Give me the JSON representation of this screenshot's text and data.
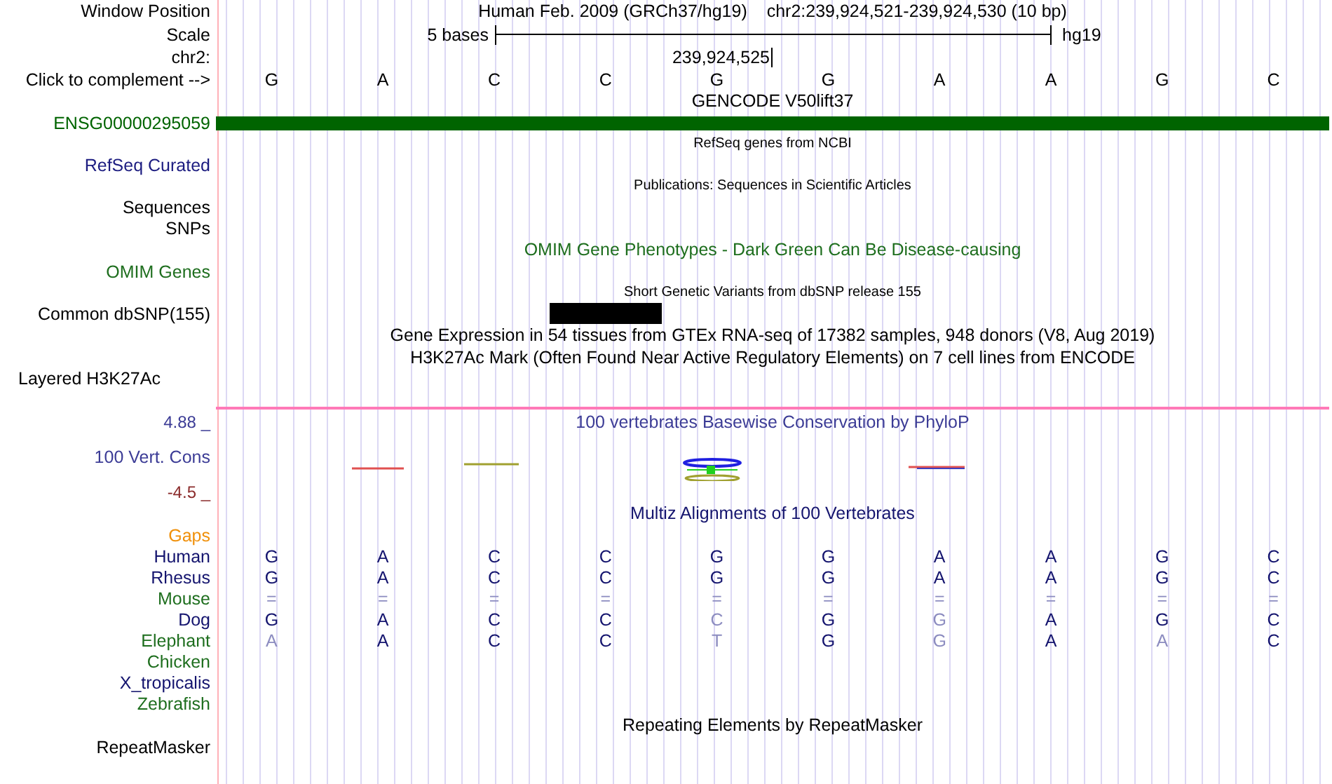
{
  "rows": [
    {
      "kind": "position",
      "label": "Window Position",
      "texts": [
        "Human Feb. 2009 (GRCh37/hg19)",
        "chr2:239,924,521-239,924,530 (10 bp)"
      ]
    },
    {
      "kind": "scale",
      "label": "Scale",
      "scale_text": "5 bases",
      "assembly": "hg19"
    },
    {
      "kind": "coordinate",
      "label": "chr2:",
      "text": "239,924,525"
    },
    {
      "kind": "bases",
      "label": "Click to complement -->",
      "bases": [
        "G",
        "A",
        "C",
        "C",
        "G",
        "G",
        "A",
        "A",
        "G",
        "C"
      ]
    },
    {
      "kind": "title",
      "text": "GENCODE V50lift37",
      "color": "#000000"
    },
    {
      "kind": "gene_bar",
      "label": "ENSG00000295059",
      "color": "#006400"
    },
    {
      "kind": "caption",
      "text": "RefSeq genes from NCBI"
    },
    {
      "kind": "label",
      "label": "RefSeq Curated",
      "color": "#1c1c80"
    },
    {
      "kind": "caption",
      "text": "Publications: Sequences in Scientific Articles"
    },
    {
      "kind": "label",
      "label": "Sequences",
      "color": "#000000"
    },
    {
      "kind": "label",
      "label": "SNPs",
      "color": "#000000"
    },
    {
      "kind": "title",
      "text": "OMIM Gene Phenotypes - Dark Green Can Be Disease-causing",
      "color": "#1e6e1e"
    },
    {
      "kind": "label",
      "label": "OMIM Genes",
      "color": "#1e6e1e"
    },
    {
      "kind": "caption",
      "text": "Short Genetic Variants from dbSNP release 155"
    },
    {
      "kind": "snp",
      "label": "Common dbSNP(155)"
    },
    {
      "kind": "title",
      "text": "Gene Expression in 54 tissues from GTEx RNA-seq of 17382 samples, 948 donors (V8, Aug 2019)",
      "color": "#000000"
    },
    {
      "kind": "title",
      "text": "H3K27Ac Mark (Often Found Near Active Regulatory Elements) on 7 cell lines from ENCODE",
      "color": "#000000"
    },
    {
      "kind": "side_label",
      "label": "Layered H3K27Ac"
    },
    {
      "kind": "divider"
    },
    {
      "kind": "wiggle_title",
      "axis_label": "4.88 _",
      "text": "100 vertebrates Basewise Conservation by PhyloP",
      "color": "#3c3c96"
    },
    {
      "kind": "wiggle",
      "label": "100 Vert. Cons",
      "color": "#3c3c96"
    },
    {
      "kind": "axis_min",
      "axis_label": "-4.5 _",
      "color": "#8b2c2c"
    },
    {
      "kind": "title",
      "text": "Multiz Alignments of 100 Vertebrates",
      "color": "#14146e"
    },
    {
      "kind": "label",
      "label": "Gaps",
      "color": "#f0900a"
    },
    {
      "kind": "species",
      "label": "Human",
      "color": "#14146e",
      "bases": [
        {
          "base": "G",
          "faded": false
        },
        {
          "base": "A",
          "faded": false
        },
        {
          "base": "C",
          "faded": false
        },
        {
          "base": "C",
          "faded": false
        },
        {
          "base": "G",
          "faded": false
        },
        {
          "base": "G",
          "faded": false
        },
        {
          "base": "A",
          "faded": false
        },
        {
          "base": "A",
          "faded": false
        },
        {
          "base": "G",
          "faded": false
        },
        {
          "base": "C",
          "faded": false
        }
      ]
    },
    {
      "kind": "species",
      "label": "Rhesus",
      "color": "#14146e",
      "bases": [
        {
          "base": "G",
          "faded": false
        },
        {
          "base": "A",
          "faded": false
        },
        {
          "base": "C",
          "faded": false
        },
        {
          "base": "C",
          "faded": false
        },
        {
          "base": "G",
          "faded": false
        },
        {
          "base": "G",
          "faded": false
        },
        {
          "base": "A",
          "faded": false
        },
        {
          "base": "A",
          "faded": false
        },
        {
          "base": "G",
          "faded": false
        },
        {
          "base": "C",
          "faded": false
        }
      ]
    },
    {
      "kind": "species",
      "label": "Mouse",
      "color": "#1e6e1e",
      "bases": [
        {
          "base": "=",
          "faded": true
        },
        {
          "base": "=",
          "faded": true
        },
        {
          "base": "=",
          "faded": true
        },
        {
          "base": "=",
          "faded": true
        },
        {
          "base": "=",
          "faded": true
        },
        {
          "base": "=",
          "faded": true
        },
        {
          "base": "=",
          "faded": true
        },
        {
          "base": "=",
          "faded": true
        },
        {
          "base": "=",
          "faded": true
        },
        {
          "base": "=",
          "faded": true
        }
      ]
    },
    {
      "kind": "species",
      "label": "Dog",
      "color": "#14146e",
      "bases": [
        {
          "base": "G",
          "faded": false
        },
        {
          "base": "A",
          "faded": false
        },
        {
          "base": "C",
          "faded": false
        },
        {
          "base": "C",
          "faded": false
        },
        {
          "base": "C",
          "faded": true
        },
        {
          "base": "G",
          "faded": false
        },
        {
          "base": "G",
          "faded": true
        },
        {
          "base": "A",
          "faded": false
        },
        {
          "base": "G",
          "faded": false
        },
        {
          "base": "C",
          "faded": false
        }
      ]
    },
    {
      "kind": "species",
      "label": "Elephant",
      "color": "#1e6e1e",
      "bases": [
        {
          "base": "A",
          "faded": true
        },
        {
          "base": "A",
          "faded": false
        },
        {
          "base": "C",
          "faded": false
        },
        {
          "base": "C",
          "faded": false
        },
        {
          "base": "T",
          "faded": true
        },
        {
          "base": "G",
          "faded": false
        },
        {
          "base": "G",
          "faded": true
        },
        {
          "base": "A",
          "faded": false
        },
        {
          "base": "A",
          "faded": true
        },
        {
          "base": "C",
          "faded": false
        }
      ]
    },
    {
      "kind": "species",
      "label": "Chicken",
      "color": "#1e6e1e"
    },
    {
      "kind": "species",
      "label": "X_tropicalis",
      "color": "#14146e"
    },
    {
      "kind": "species",
      "label": "Zebrafish",
      "color": "#1e6e1e"
    },
    {
      "kind": "title",
      "text": "Repeating Elements by RepeatMasker",
      "color": "#000000"
    },
    {
      "kind": "label",
      "label": "RepeatMasker",
      "color": "#000000"
    }
  ]
}
